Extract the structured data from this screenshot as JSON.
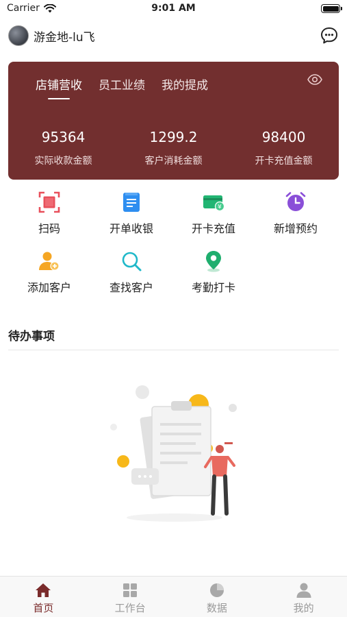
{
  "status_bar": {
    "carrier": "Carrier",
    "time": "9:01 AM"
  },
  "header": {
    "username": "游金地-lu飞"
  },
  "card": {
    "background": "#722f2f",
    "tabs": [
      {
        "label": "店铺营收",
        "active": true
      },
      {
        "label": "员工业绩",
        "active": false
      },
      {
        "label": "我的提成",
        "active": false
      }
    ],
    "stats": [
      {
        "value": "95364",
        "label": "实际收款金额"
      },
      {
        "value": "1299.2",
        "label": "客户消耗金额"
      },
      {
        "value": "98400",
        "label": "开卡充值金额"
      }
    ]
  },
  "actions": [
    {
      "label": "扫码",
      "icon": "scan-icon",
      "color": "#e8505b"
    },
    {
      "label": "开单收银",
      "icon": "receipt-icon",
      "color": "#2e8ef0"
    },
    {
      "label": "开卡充值",
      "icon": "card-recharge-icon",
      "color": "#22b573"
    },
    {
      "label": "新增预约",
      "icon": "alarm-clock-icon",
      "color": "#8a4fd8"
    },
    {
      "label": "添加客户",
      "icon": "add-user-icon",
      "color": "#f5a623"
    },
    {
      "label": "查找客户",
      "icon": "search-icon",
      "color": "#1fb8c9"
    },
    {
      "label": "考勤打卡",
      "icon": "location-pin-icon",
      "color": "#1fae6e"
    }
  ],
  "todo": {
    "title": "待办事项"
  },
  "bottom_nav": [
    {
      "label": "首页",
      "icon": "home-icon",
      "active": true
    },
    {
      "label": "工作台",
      "icon": "grid-icon",
      "active": false
    },
    {
      "label": "数据",
      "icon": "pie-chart-icon",
      "active": false
    },
    {
      "label": "我的",
      "icon": "user-icon",
      "active": false
    }
  ],
  "colors": {
    "accent": "#7a2b2b",
    "inactive": "#9a9a9a"
  }
}
